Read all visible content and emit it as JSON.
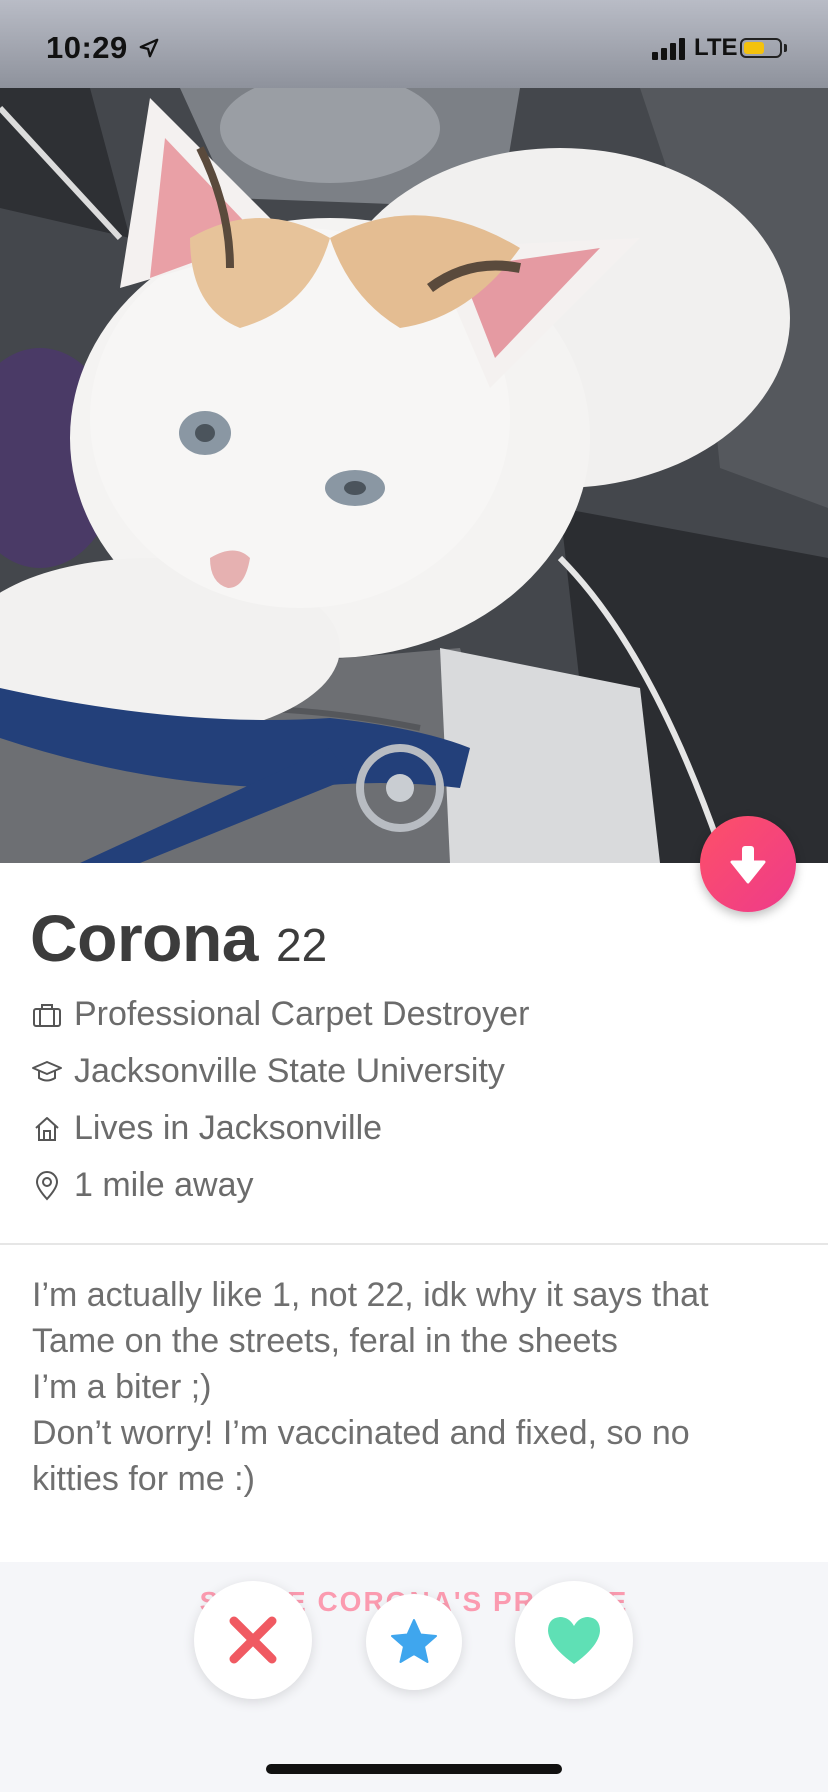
{
  "status_bar": {
    "time": "10:29",
    "network": "LTE",
    "battery_level": 0.6,
    "battery_color": "#f4c20d"
  },
  "profile": {
    "name": "Corona",
    "age": "22",
    "details": [
      {
        "icon": "briefcase-icon",
        "text": "Professional Carpet Destroyer"
      },
      {
        "icon": "graduation-cap-icon",
        "text": "Jacksonville State University"
      },
      {
        "icon": "home-icon",
        "text": "Lives in Jacksonville"
      },
      {
        "icon": "location-pin-icon",
        "text": "1 mile away"
      }
    ],
    "bio_lines": [
      "I’m actually like 1, not 22, idk why it says that",
      "Tame on the streets, feral in the sheets",
      "I’m a biter ;)",
      "Don’t worry! I’m vaccinated and fixed, so no",
      "kitties for me :)"
    ]
  },
  "share_text": "SHARE CORONA'S PROFILE",
  "actions": {
    "nope": "close-icon",
    "super_like": "star-icon",
    "like": "heart-icon"
  },
  "colors": {
    "brand_gradient_start": "#fd5068",
    "brand_gradient_end": "#ee3b8a",
    "nope": "#f05a62",
    "super_like": "#3fa6ee",
    "like": "#5fe0b5"
  }
}
